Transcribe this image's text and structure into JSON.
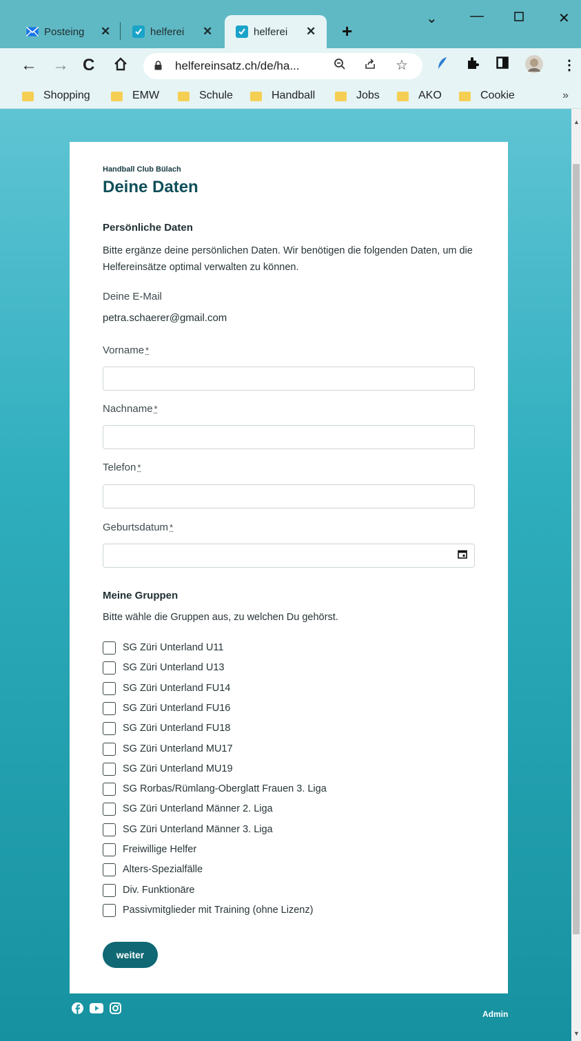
{
  "browser": {
    "tabs": [
      {
        "title": "Posteing",
        "favicon": "mail-icon"
      },
      {
        "title": "helferei",
        "favicon": "helfereinsatz-icon"
      },
      {
        "title": "helferei",
        "favicon": "helfereinsatz-icon",
        "active": true
      }
    ],
    "new_tab": "+",
    "url": "helfereinsatz.ch/de/ha...",
    "bookmarks": [
      "Shopping",
      "EMW",
      "Schule",
      "Handball",
      "Jobs",
      "AKO",
      "Cookie"
    ],
    "bookmarks_more": "»"
  },
  "page": {
    "club_name": "Handball Club Bülach",
    "title": "Deine Daten",
    "personal_heading": "Persönliche Daten",
    "personal_text": "Bitte ergänze deine persönlichen Daten. Wir benötigen die folgenden Daten, um die Helfereinsätze optimal verwalten zu können.",
    "email_label": "Deine E-Mail",
    "email_value": "petra.schaerer@gmail.com",
    "required_mark": "*",
    "fields": {
      "firstname_label": "Vorname",
      "lastname_label": "Nachname",
      "phone_label": "Telefon",
      "birthdate_label": "Geburtsdatum"
    },
    "groups_heading": "Meine Gruppen",
    "groups_text": "Bitte wähle die Gruppen aus, zu welchen Du gehörst.",
    "groups": [
      "SG Züri Unterland U11",
      "SG Züri Unterland U13",
      "SG Züri Unterland FU14",
      "SG Züri Unterland FU16",
      "SG Züri Unterland FU18",
      "SG Züri Unterland MU17",
      "SG Züri Unterland MU19",
      "SG Rorbas/Rümlang-Oberglatt Frauen 3. Liga",
      "SG Züri Unterland Männer 2. Liga",
      "SG Züri Unterland Männer 3. Liga",
      "Freiwillige Helfer",
      "Alters-Spezialfälle",
      "Div. Funktionäre",
      "Passivmitglieder mit Training (ohne Lizenz)"
    ],
    "submit_label": "weiter",
    "footer_admin": "Admin"
  },
  "colors": {
    "accent": "#0f6873",
    "title": "#0f4e58",
    "background_top": "#5fc4d4",
    "background_bottom": "#16919f"
  }
}
